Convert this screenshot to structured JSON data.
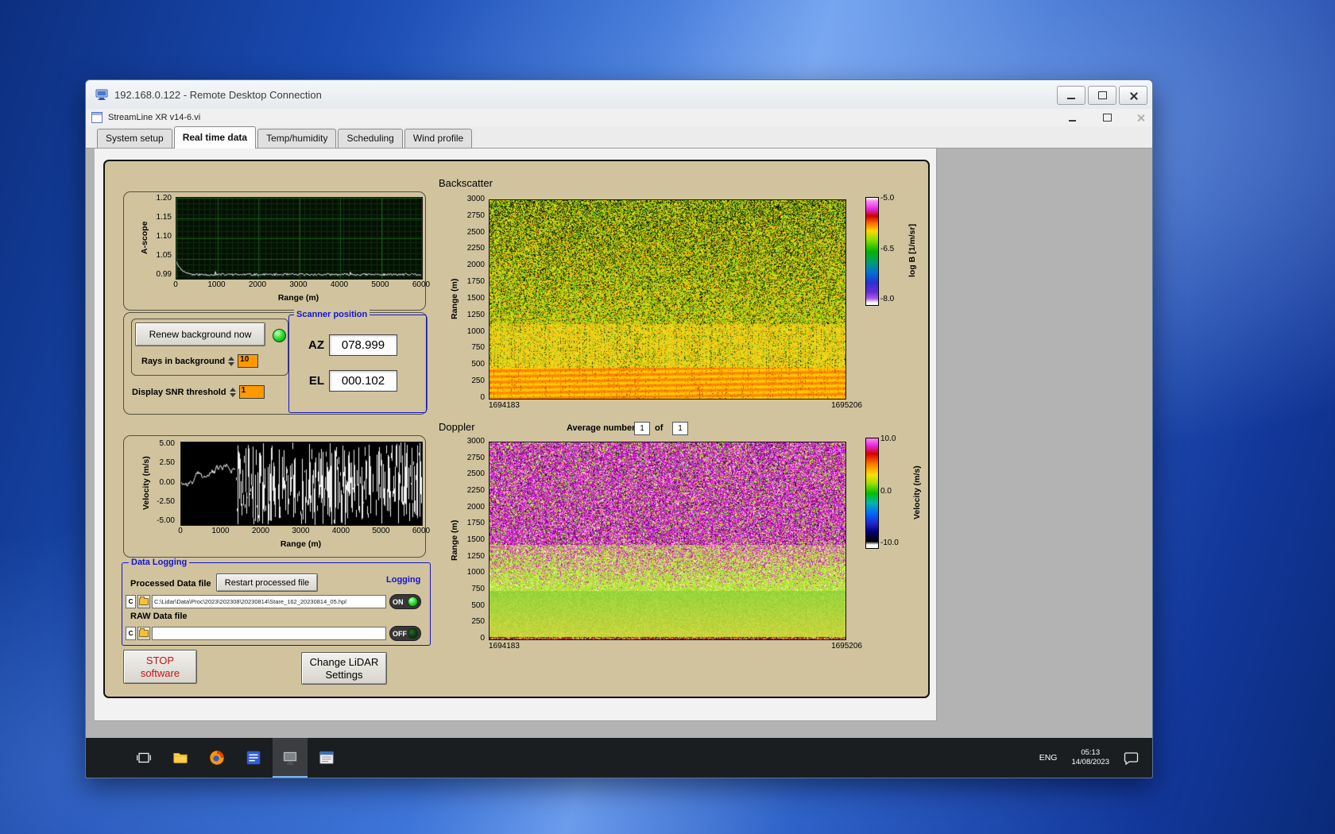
{
  "rdp": {
    "title": "192.168.0.122 - Remote Desktop Connection"
  },
  "app": {
    "title": "StreamLine XR v14-6.vi",
    "tabs": [
      {
        "label": "System setup",
        "active": false
      },
      {
        "label": "Real time data",
        "active": true
      },
      {
        "label": "Temp/humidity",
        "active": false
      },
      {
        "label": "Scheduling",
        "active": false
      },
      {
        "label": "Wind profile",
        "active": false
      }
    ]
  },
  "ascope": {
    "ylabel": "A-scope",
    "xlabel": "Range (m)",
    "yticks": [
      "1.20",
      "1.15",
      "1.10",
      "1.05",
      "0.99"
    ],
    "xticks": [
      "0",
      "1000",
      "2000",
      "3000",
      "4000",
      "5000",
      "6000"
    ]
  },
  "controls": {
    "renew_button": "Renew background now",
    "rays_label": "Rays in background",
    "rays_value": "10",
    "snr_label": "Display SNR threshold",
    "snr_value": "1"
  },
  "scanner": {
    "title": "Scanner position",
    "az_label": "AZ",
    "az_value": "078.999",
    "el_label": "EL",
    "el_value": "000.102"
  },
  "backscatter": {
    "title": "Backscatter",
    "ylabel": "Range (m)",
    "yticks": [
      "3000",
      "2750",
      "2500",
      "2250",
      "2000",
      "1750",
      "1500",
      "1250",
      "1000",
      "750",
      "500",
      "250",
      "0"
    ],
    "x_start": "1694183",
    "x_end": "1695206",
    "cb_ticks": [
      "-5.0",
      "-6.5",
      "-8.0"
    ],
    "cb_label": "log B [1/m/sr]"
  },
  "doppler": {
    "title": "Doppler",
    "avg_label": "Average number",
    "avg_value": "1",
    "of_label": "of",
    "count_value": "1",
    "ylabel": "Range (m)",
    "yticks": [
      "3000",
      "2750",
      "2500",
      "2250",
      "2000",
      "1750",
      "1500",
      "1250",
      "1000",
      "750",
      "500",
      "250",
      "0"
    ],
    "x_start": "1694183",
    "x_end": "1695206",
    "cb_ticks": [
      "10.0",
      "0.0",
      "-10.0"
    ],
    "cb_label": "Velocity (m/s)"
  },
  "velocity": {
    "ylabel": "Velocity (m/s)",
    "xlabel": "Range (m)",
    "yticks": [
      "5.00",
      "2.50",
      "0.00",
      "-2.50",
      "-5.00"
    ],
    "xticks": [
      "0",
      "1000",
      "2000",
      "3000",
      "4000",
      "5000",
      "6000"
    ]
  },
  "logging": {
    "title": "Data Logging",
    "processed_label": "Processed Data file",
    "restart_button": "Restart processed file",
    "logging_label": "Logging",
    "drive_label": "C",
    "processed_path": "C:\\Lidar\\Data\\Proc\\2023\\202308\\20230814\\Stare_162_20230814_05.hpl",
    "on_label": "ON",
    "raw_label": "RAW Data file",
    "raw_path": "",
    "off_label": "OFF"
  },
  "actions": {
    "stop_line1": "STOP",
    "stop_line2": "software",
    "change_line1": "Change LiDAR",
    "change_line2": "Settings"
  },
  "taskbar": {
    "lang": "ENG",
    "time": "05:13",
    "date": "14/08/2023"
  },
  "chart_data": [
    {
      "type": "line",
      "title": "A-scope",
      "xlabel": "Range (m)",
      "ylabel": "A-scope",
      "xlim": [
        0,
        6000
      ],
      "ylim": [
        0.99,
        1.2
      ],
      "grid": true,
      "description": "White noisy trace near 1.00 across full range with an initial bump to about 1.04 below ~300 m"
    },
    {
      "type": "line",
      "title": "Velocity vs range",
      "xlabel": "Range (m)",
      "ylabel": "Velocity (m/s)",
      "xlim": [
        0,
        6000
      ],
      "ylim": [
        -5,
        5
      ],
      "description": "Coherent trace rising from 0 to ~2.5 m/s below ~1400 m, then saturated random noise spanning -5 to +5 m/s out to 6000 m"
    },
    {
      "type": "heatmap",
      "title": "Backscatter",
      "ylabel": "Range (m)",
      "ylim": [
        0,
        3000
      ],
      "x_range": [
        1694183,
        1695206
      ],
      "colorbar_label": "log B [1/m/sr]",
      "colorbar_range": [
        -8.0,
        -5.0
      ],
      "description": "Strong orange/yellow returns below ~500 m, yellow-green layer to ~1300 m, noisy yellow/green/dark speckle aloft"
    },
    {
      "type": "heatmap",
      "title": "Doppler",
      "ylabel": "Range (m)",
      "ylim": [
        0,
        3000
      ],
      "x_range": [
        1694183,
        1695206
      ],
      "colorbar_label": "Velocity (m/s)",
      "colorbar_range": [
        -10,
        10
      ],
      "description": "Smooth green/yellow velocities below ~1000 m, magenta/purple random noise above where SNR is low"
    }
  ]
}
